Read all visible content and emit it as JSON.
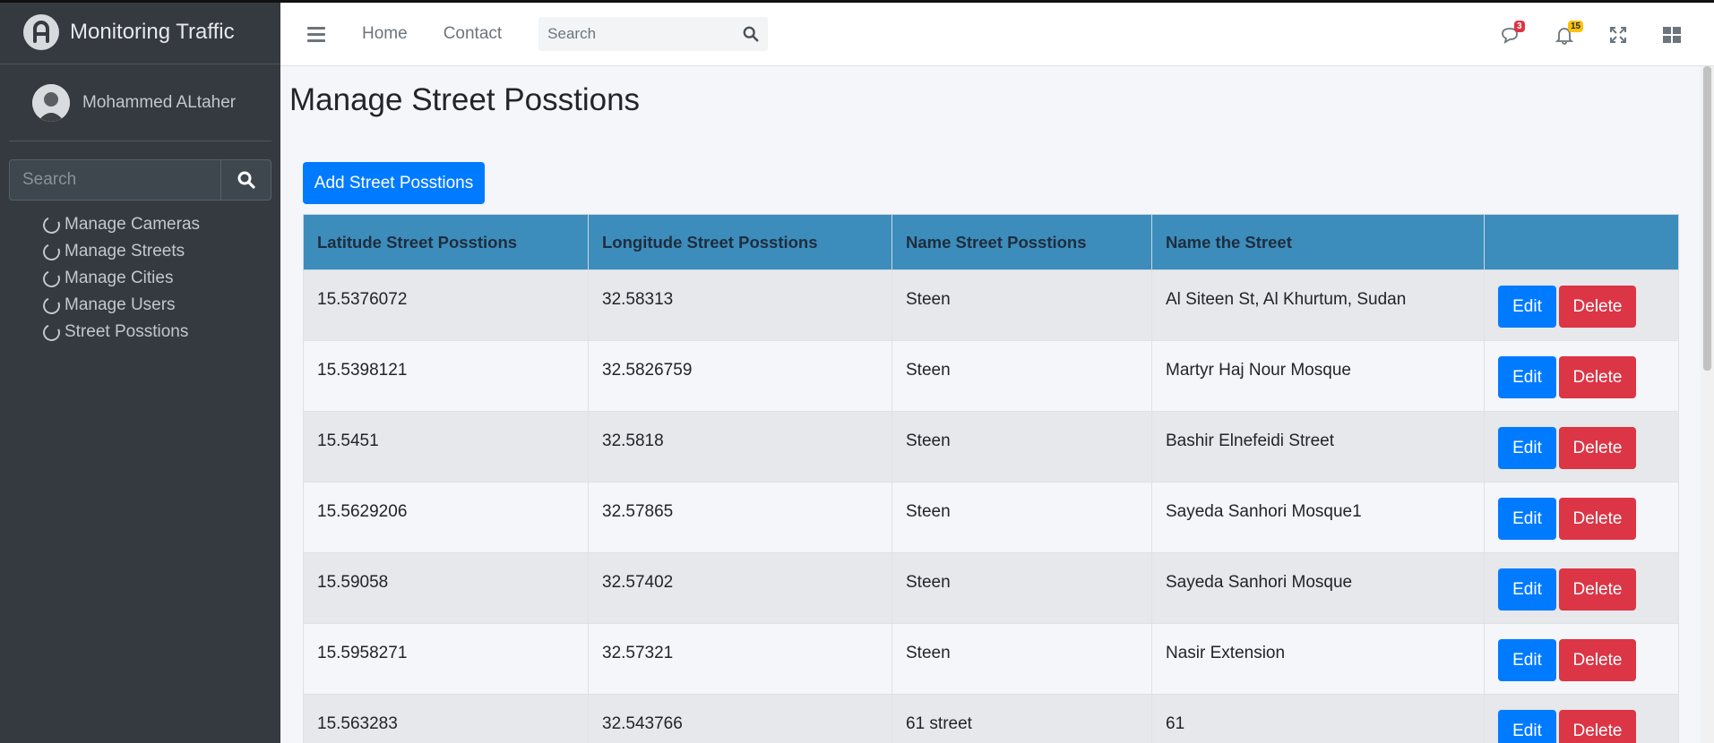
{
  "app": {
    "title": "Monitoring Traffic"
  },
  "user": {
    "name": "Mohammed ALtaher"
  },
  "sidebar": {
    "search_placeholder": "Search",
    "items": [
      {
        "label": "Manage Cameras"
      },
      {
        "label": "Manage Streets"
      },
      {
        "label": "Manage Cities"
      },
      {
        "label": "Manage Users"
      },
      {
        "label": "Street Posstions"
      }
    ]
  },
  "header": {
    "nav": [
      {
        "label": "Home"
      },
      {
        "label": "Contact"
      }
    ],
    "search_placeholder": "Search",
    "messages_badge": "3",
    "notifications_badge": "15"
  },
  "main": {
    "title": "Manage Street Posstions",
    "add_button": "Add Street Posstions",
    "table": {
      "headers": [
        "Latitude Street Posstions",
        "Longitude Street Posstions",
        "Name Street Posstions",
        "Name the Street",
        ""
      ],
      "rows": [
        [
          "15.5376072",
          "32.58313",
          "Steen",
          "Al Siteen St, Al Khurtum, Sudan"
        ],
        [
          "15.5398121",
          "32.5826759",
          "Steen",
          "Martyr Haj Nour Mosque"
        ],
        [
          "15.5451",
          "32.5818",
          "Steen",
          "Bashir Elnefeidi Street"
        ],
        [
          "15.5629206",
          "32.57865",
          "Steen",
          "Sayeda Sanhori Mosque1"
        ],
        [
          "15.59058",
          "32.57402",
          "Steen",
          "Sayeda Sanhori Mosque"
        ],
        [
          "15.5958271",
          "32.57321",
          "Steen",
          "Nasir Extension"
        ],
        [
          "15.563283",
          "32.543766",
          "61 street",
          "61"
        ]
      ],
      "edit_label": "Edit",
      "delete_label": "Delete"
    }
  },
  "colors": {
    "sidebar_bg": "#343a40",
    "table_header": "#3c8dbc",
    "primary": "#007bff",
    "danger": "#dc3545"
  }
}
